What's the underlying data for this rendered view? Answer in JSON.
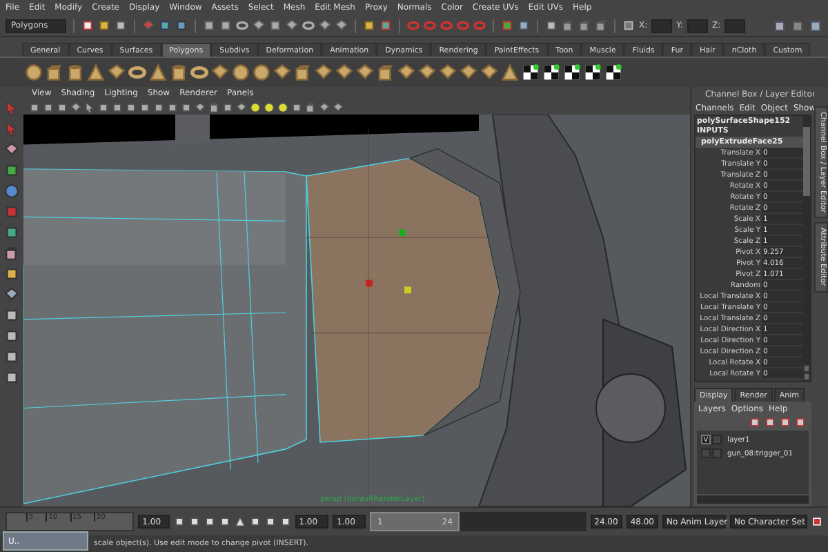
{
  "menu_bar": [
    "File",
    "Edit",
    "Modify",
    "Create",
    "Display",
    "Window",
    "Assets",
    "Select",
    "Mesh",
    "Edit Mesh",
    "Proxy",
    "Normals",
    "Color",
    "Create UVs",
    "Edit UVs",
    "Help"
  ],
  "status_line": {
    "mode": "Polygons",
    "coord_labels": [
      "X:",
      "Y:",
      "Z:"
    ]
  },
  "shelf_tabs": [
    {
      "label": "General",
      "selected": false
    },
    {
      "label": "Curves",
      "selected": false
    },
    {
      "label": "Surfaces",
      "selected": false
    },
    {
      "label": "Polygons",
      "selected": true
    },
    {
      "label": "Subdivs",
      "selected": false
    },
    {
      "label": "Deformation",
      "selected": false
    },
    {
      "label": "Animation",
      "selected": false
    },
    {
      "label": "Dynamics",
      "selected": false
    },
    {
      "label": "Rendering",
      "selected": false
    },
    {
      "label": "PaintEffects",
      "selected": false
    },
    {
      "label": "Toon",
      "selected": false
    },
    {
      "label": "Muscle",
      "selected": false
    },
    {
      "label": "Fluids",
      "selected": false
    },
    {
      "label": "Fur",
      "selected": false
    },
    {
      "label": "Hair",
      "selected": false
    },
    {
      "label": "nCloth",
      "selected": false
    },
    {
      "label": "Custom",
      "selected": false
    }
  ],
  "viewport": {
    "menu": [
      "View",
      "Shading",
      "Lighting",
      "Show",
      "Renderer",
      "Panels"
    ],
    "camera_label": "persp (defaultRenderLayer)"
  },
  "channel_box": {
    "title": "Channel Box / Layer Editor",
    "menu": [
      "Channels",
      "Edit",
      "Object",
      "Show"
    ],
    "shape": "polySurfaceShape152",
    "inputs_label": "INPUTS",
    "node": "polyExtrudeFace25",
    "channels": [
      {
        "name": "Translate X",
        "value": "0"
      },
      {
        "name": "Translate Y",
        "value": "0"
      },
      {
        "name": "Translate Z",
        "value": "0"
      },
      {
        "name": "Rotate X",
        "value": "0"
      },
      {
        "name": "Rotate Y",
        "value": "0"
      },
      {
        "name": "Rotate Z",
        "value": "0"
      },
      {
        "name": "Scale X",
        "value": "1"
      },
      {
        "name": "Scale Y",
        "value": "1"
      },
      {
        "name": "Scale Z",
        "value": "1"
      },
      {
        "name": "Pivot X",
        "value": "9.257"
      },
      {
        "name": "Pivot Y",
        "value": "4.016"
      },
      {
        "name": "Pivot Z",
        "value": "1.071"
      },
      {
        "name": "Random",
        "value": "0"
      },
      {
        "name": "Local Translate X",
        "value": "0"
      },
      {
        "name": "Local Translate Y",
        "value": "0"
      },
      {
        "name": "Local Translate Z",
        "value": "0"
      },
      {
        "name": "Local Direction X",
        "value": "1"
      },
      {
        "name": "Local Direction Y",
        "value": "0"
      },
      {
        "name": "Local Direction Z",
        "value": "0"
      },
      {
        "name": "Local Rotate X",
        "value": "0"
      },
      {
        "name": "Local Rotate Y",
        "value": "0"
      }
    ]
  },
  "layer_editor": {
    "tabs": [
      {
        "label": "Display",
        "selected": true
      },
      {
        "label": "Render",
        "selected": false
      },
      {
        "label": "Anim",
        "selected": false
      }
    ],
    "menu": [
      "Layers",
      "Options",
      "Help"
    ],
    "layers": [
      {
        "name": "layer1",
        "visible": true,
        "visibility_mark": "V"
      },
      {
        "name": "gun_08:trigger_01",
        "visible": false
      }
    ]
  },
  "side_tabs": [
    "Channel Box / Layer Editor",
    "Attribute Editor"
  ],
  "timeline": {
    "ticks": [
      "5",
      "10",
      "15",
      "20"
    ],
    "current_time": "1.00",
    "start_time": "1.00",
    "playback_start": "1.00",
    "range_slider": {
      "start": "1",
      "end": "24",
      "level": 0.38
    },
    "playback_end": "24.00",
    "end_time": "48.00",
    "anim_layer": "No Anim Layer",
    "character_set": "No Character Set"
  },
  "help_line": "scale object(s). Use edit mode to change pivot (INSERT).",
  "minimized_window": {
    "title": "U.."
  }
}
